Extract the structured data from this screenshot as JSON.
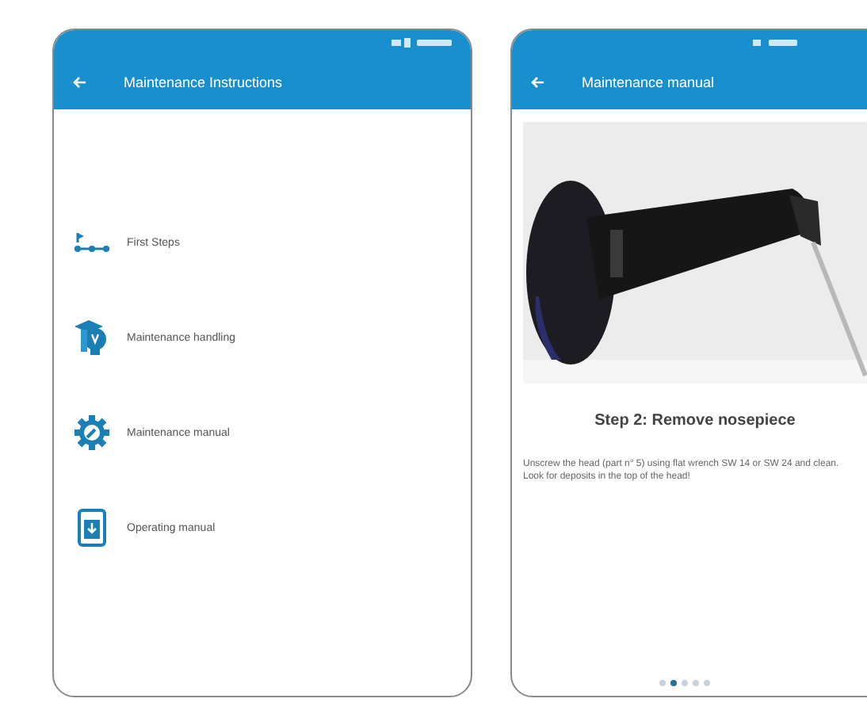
{
  "left_screen": {
    "title": "Maintenance Instructions",
    "menu_items": [
      {
        "kind": "steps",
        "label": "First Steps"
      },
      {
        "kind": "bulb",
        "label": "Maintenance handling"
      },
      {
        "kind": "gear",
        "label": "Maintenance manual"
      },
      {
        "kind": "document",
        "label": "Operating manual"
      }
    ]
  },
  "right_screen": {
    "title": "Maintenance manual",
    "step_title": "Step 2: Remove nosepiece",
    "step_text": "Unscrew the head (part n° 5) using flat wrench SW 14 or SW 24 and clean. Look for deposits in the top of the head!",
    "pages": [
      {
        "selected": false
      },
      {
        "selected": true
      },
      {
        "selected": false
      },
      {
        "selected": false
      },
      {
        "selected": false
      }
    ]
  }
}
